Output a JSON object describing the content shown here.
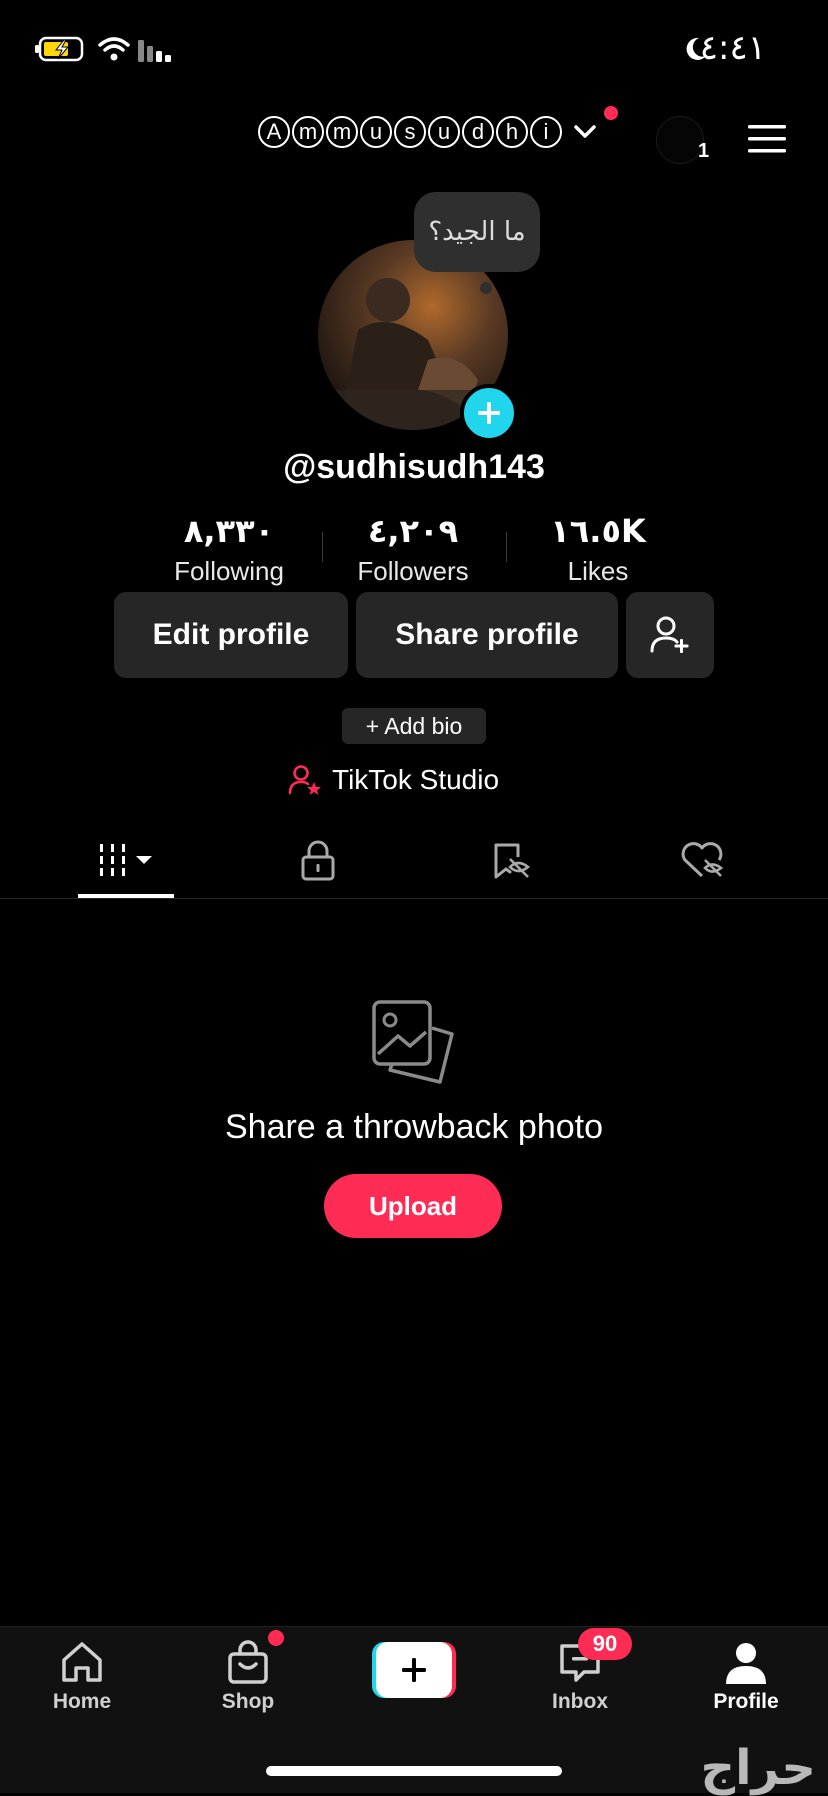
{
  "status_bar": {
    "time": "٤:٤١"
  },
  "header": {
    "username_chars": [
      "A",
      "m",
      "m",
      "u",
      "s",
      "u",
      "d",
      "h",
      "i"
    ],
    "notification_count": "1"
  },
  "tooltip": {
    "text": "ما الجيد؟"
  },
  "profile": {
    "handle": "@sudhisudh143",
    "stats": [
      {
        "value": "٨,٣٣٠",
        "label": "Following"
      },
      {
        "value": "٤,٢٠٩",
        "label": "Followers"
      },
      {
        "value": "١٦.٥K",
        "label": "Likes"
      }
    ],
    "edit_label": "Edit profile",
    "share_label": "Share profile",
    "add_bio": "+ Add bio",
    "studio_label": "TikTok Studio"
  },
  "empty_state": {
    "title": "Share a throwback photo",
    "upload_label": "Upload"
  },
  "bottom_nav": {
    "items": [
      {
        "label": "Home"
      },
      {
        "label": "Shop"
      },
      {
        "label": "Inbox"
      },
      {
        "label": "Profile"
      }
    ],
    "inbox_badge": "90"
  },
  "watermark": {
    "text": "حراج"
  },
  "colors": {
    "accent": "#fe2c55",
    "cyan": "#20d5ec",
    "surface": "#262626",
    "background": "#000000"
  },
  "icons": [
    "battery-charging-icon",
    "wifi-icon",
    "signal-icon",
    "moon-icon",
    "chevron-down-icon",
    "hamburger-menu-icon",
    "add-friend-icon",
    "studio-icon",
    "grid-tab-icon",
    "lock-tab-icon",
    "repost-tab-icon",
    "liked-tab-icon",
    "photo-icon",
    "home-icon",
    "shop-icon",
    "create-plus-icon",
    "inbox-icon",
    "profile-icon"
  ]
}
